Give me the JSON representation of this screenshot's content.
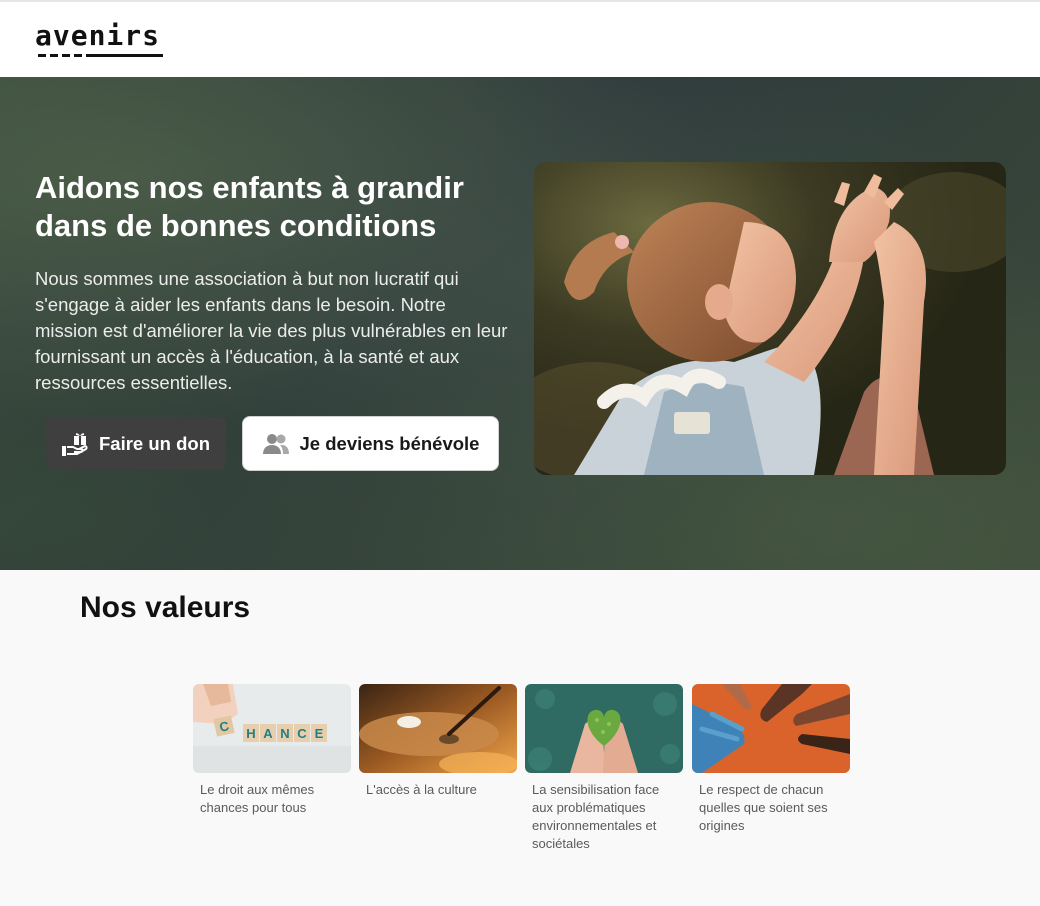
{
  "header": {
    "logo_text": "avenirs"
  },
  "hero": {
    "title": "Aidons nos enfants à grandir dans de bonnes conditions",
    "description": "Nous sommes une association à but non lucratif qui s'engage à aider les enfants dans le besoin. Notre mission est d'améliorer la vie des plus vulnérables en leur fournissant un accès à l'éducation, à la santé et aux ressources essentielles.",
    "donate_label": "Faire un don",
    "volunteer_label": "Je deviens bénévole",
    "donate_icon": "gift-hand-icon",
    "volunteer_icon": "users-icon"
  },
  "values": {
    "title": "Nos valeurs",
    "cards": [
      {
        "caption": "Le droit aux mêmes chances pour tous",
        "image": "chance-blocks-image",
        "blocks": [
          "C",
          "H",
          "A",
          "N",
          "C",
          "E"
        ]
      },
      {
        "caption": "L'accès à la culture",
        "image": "paint-palette-image"
      },
      {
        "caption": "La sensibilisation face aux problématiques environnementales et sociétales",
        "image": "hands-moss-heart-image"
      },
      {
        "caption": "Le respect de chacun quelles que soient ses origines",
        "image": "diverse-hands-image"
      }
    ]
  },
  "colors": {
    "hero_bg": "#34423a",
    "donate_bg": "#3f3f3f",
    "volunteer_bg": "#ffffff",
    "page_bg": "#f9f9f9"
  }
}
